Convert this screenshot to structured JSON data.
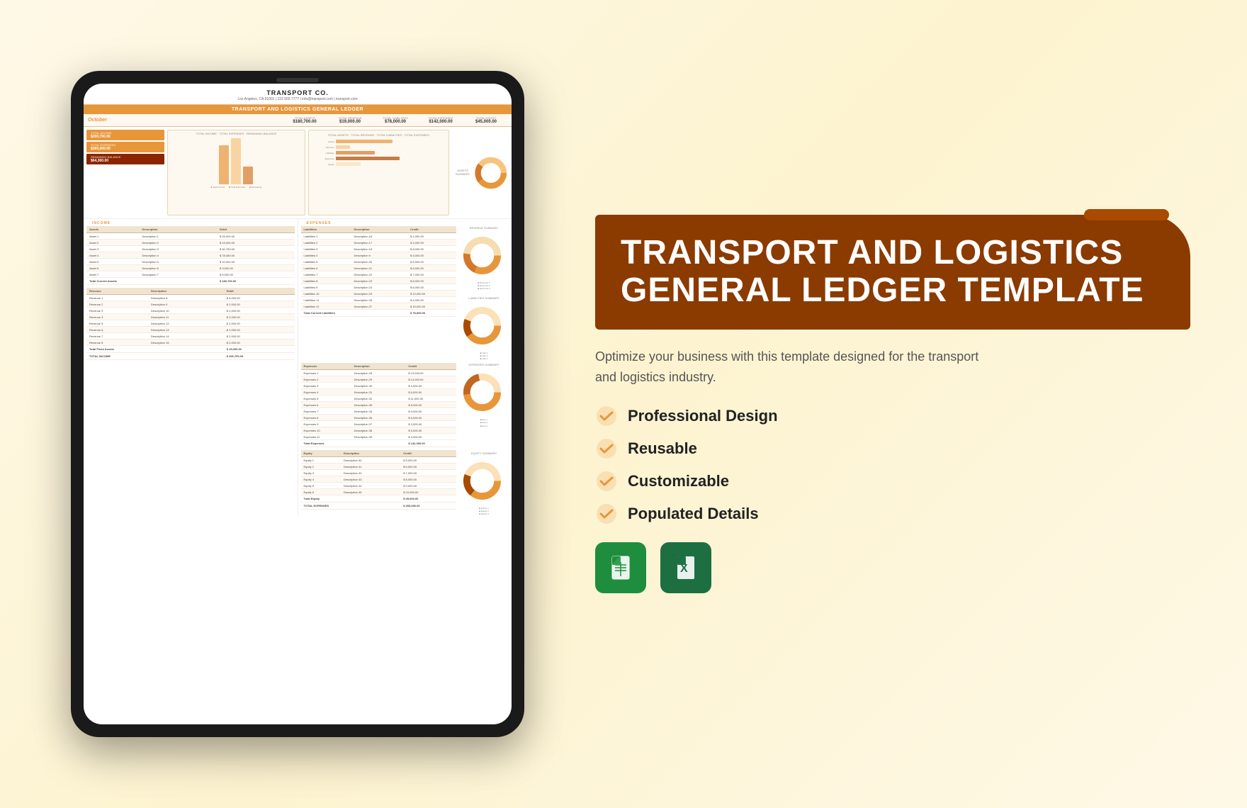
{
  "background": {
    "color": "#fef9e7"
  },
  "tablet": {
    "company_name": "TRANSPORT CO.",
    "address": "Los Angeles, CA 91001 | 222 555 7777 | info@transport.com | transport.com",
    "spreadsheet_title": "TRANSPORT AND LOGISTICS GENERAL LEDGER",
    "month": "October",
    "kpis": [
      {
        "label": "TOTAL ASSETS",
        "value": "$180,700.00"
      },
      {
        "label": "TOTAL REVENUE",
        "value": "$19,000.00"
      },
      {
        "label": "TOTAL LIABILITIES",
        "value": "$78,000.00"
      },
      {
        "label": "TOTAL EXPENSES",
        "value": "$142,000.00"
      },
      {
        "label": "TOTAL EQUITY",
        "value": "$45,000.00"
      }
    ],
    "summary_cards": [
      {
        "label": "TOTAL INCOME",
        "value": "$200,700.00"
      },
      {
        "label": "TOTAL EXPENSES",
        "value": "$265,000.00"
      },
      {
        "label": "REMAINING BALANCE",
        "value": "$64,300.00"
      }
    ],
    "income_section": "INCOME",
    "expenses_section": "EXPENSES",
    "assets_label": "Assets",
    "description_label": "Description",
    "debit_label": "Debit",
    "liabilities_label": "Liabilities",
    "credit_label": "Credit",
    "total_current_assets": "$180,700.00",
    "total_current_liabilities": "$78,000.00",
    "revenue_label": "Revenue",
    "total_fixed_assets": "$19,000.00",
    "total_income": "$200,700.00",
    "total_expenses_val": "$265,000.00",
    "total_equity_val": "$45,000.00"
  },
  "right_panel": {
    "title_line1": "TRANSPORT AND LOGISTICS",
    "title_line2": "GENERAL LEDGER TEMPLATE",
    "description": "Optimize your business with this template designed for the transport and logistics industry.",
    "features": [
      {
        "label": "Professional Design"
      },
      {
        "label": "Reusable"
      },
      {
        "label": "Customizable"
      },
      {
        "label": "Populated Details"
      }
    ],
    "format_icons": [
      {
        "name": "Google Sheets",
        "letter": "≡"
      },
      {
        "name": "Microsoft Excel",
        "letter": "X"
      }
    ]
  }
}
